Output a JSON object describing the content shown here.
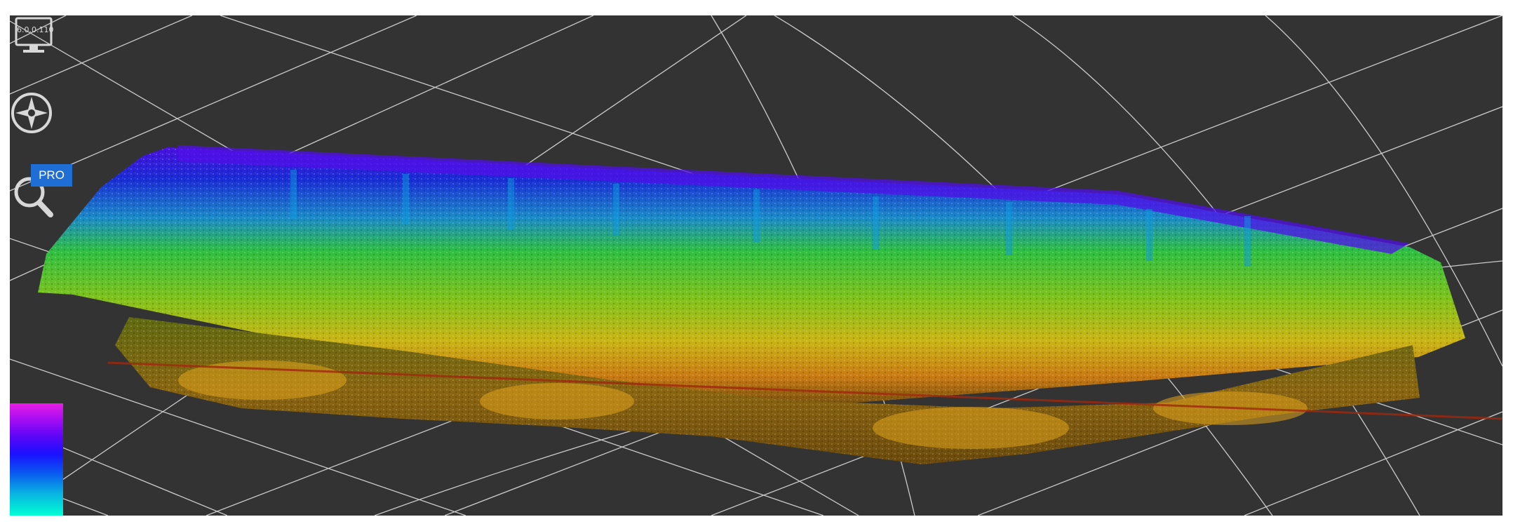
{
  "toolbar": {
    "monitor_label": "6.0.0.110",
    "pro_badge": "PRO",
    "icons": [
      "monitor-icon",
      "compass-icon",
      "search-icon"
    ]
  },
  "viewer": {
    "background_color": "#333333",
    "grid_color": "#e6e6e6",
    "colormap": [
      "#e81ee6",
      "#5a06f8",
      "#1a10ff",
      "#08b2e2",
      "#00ffd4",
      "#3ecb2a",
      "#9ecf1a",
      "#f0d21a",
      "#e8831a",
      "#6b4a10"
    ]
  }
}
